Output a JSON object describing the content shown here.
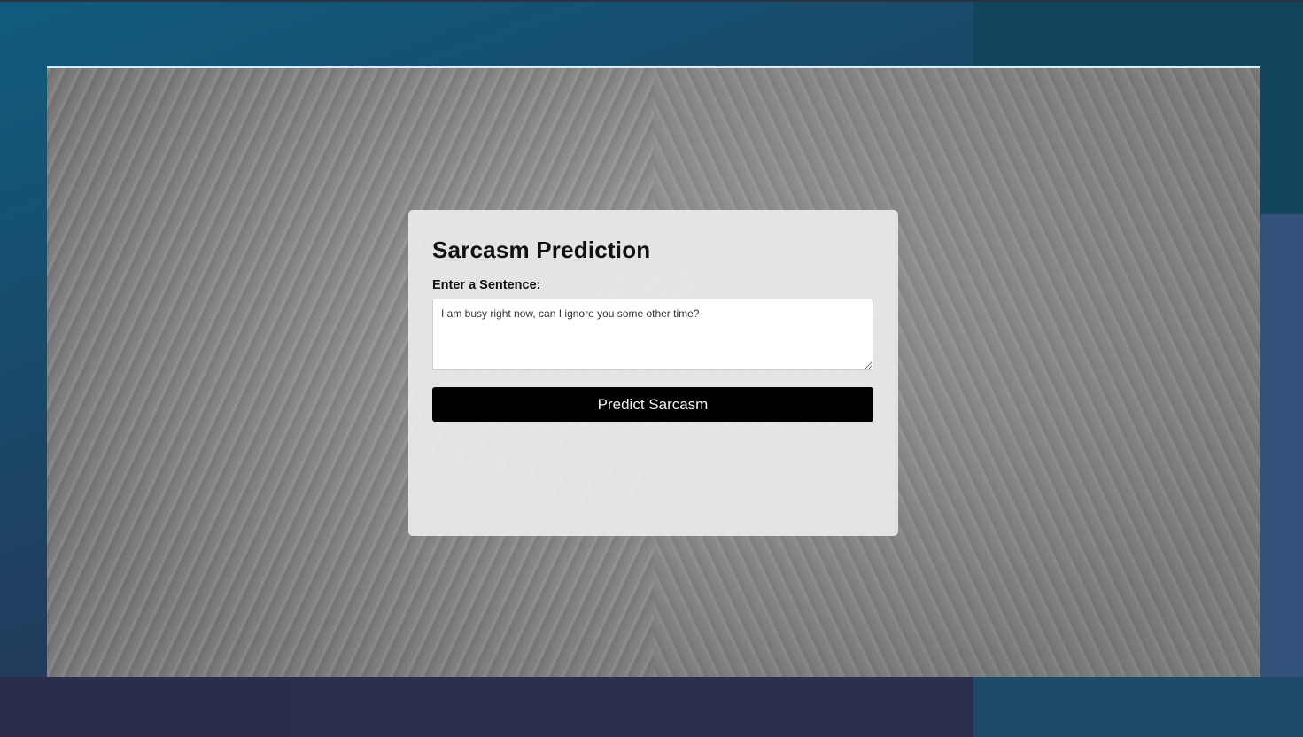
{
  "page": {
    "background_colors": {
      "gradient_top": "#0f5b7f",
      "gradient_bottom": "#2a2d4c",
      "card_background": "#ebebeb",
      "button_background": "#000000",
      "button_text": "#f2f2f2"
    }
  },
  "form": {
    "title": "Sarcasm Prediction",
    "sentence_label": "Enter a Sentence:",
    "sentence_value": "I am busy right now, can I ignore you some other time?",
    "submit_label": "Predict Sarcasm"
  },
  "result": {
    "text": ""
  }
}
